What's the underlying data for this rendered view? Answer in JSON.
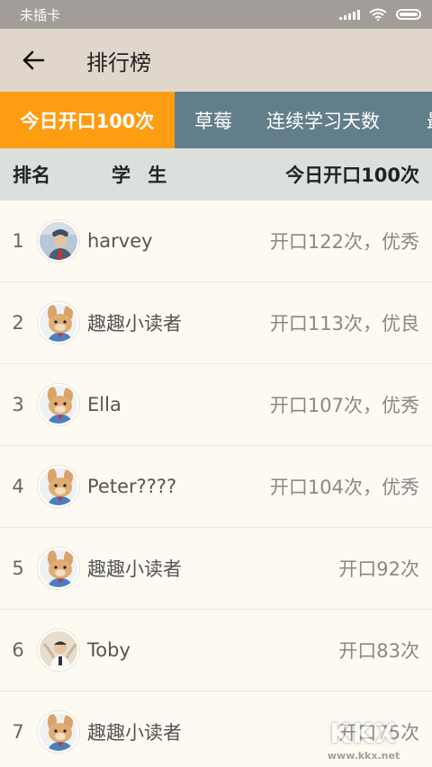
{
  "status_bar": {
    "carrier": "未插卡"
  },
  "app_bar": {
    "back_icon": "back-arrow-icon",
    "title": "排行榜"
  },
  "tabs": [
    {
      "label": "今日开口100次",
      "active": true
    },
    {
      "label": "草莓",
      "active": false
    },
    {
      "label": "连续学习天数",
      "active": false
    },
    {
      "label": "最",
      "active": false
    }
  ],
  "columns": {
    "rank": "排名",
    "student": "学 生",
    "score": "今日开口100次"
  },
  "rows": [
    {
      "rank": "1",
      "name": "harvey",
      "score": "开口122次，优秀",
      "avatar": "boy-soldier-avatar"
    },
    {
      "rank": "2",
      "name": "趣趣小读者",
      "score": "开口113次，优良",
      "avatar": "rabbit-avatar"
    },
    {
      "rank": "3",
      "name": "Ella",
      "score": "开口107次，优秀",
      "avatar": "rabbit-avatar"
    },
    {
      "rank": "4",
      "name": "Peter????",
      "score": "开口104次，优秀",
      "avatar": "rabbit-avatar"
    },
    {
      "rank": "5",
      "name": "趣趣小读者",
      "score": "开口92次",
      "avatar": "rabbit-avatar"
    },
    {
      "rank": "6",
      "name": "Toby",
      "score": "开口83次",
      "avatar": "boy-photo-avatar"
    },
    {
      "rank": "7",
      "name": "趣趣小读者",
      "score": "开口75次",
      "avatar": "rabbit-avatar"
    }
  ],
  "watermark": {
    "logo": "KKX",
    "url": "www.kkx.net"
  },
  "colors": {
    "accent": "#ff9d12",
    "tab_bar": "#627e8b",
    "app_bar": "#e0d6cb",
    "header_row": "#dce0dc"
  }
}
